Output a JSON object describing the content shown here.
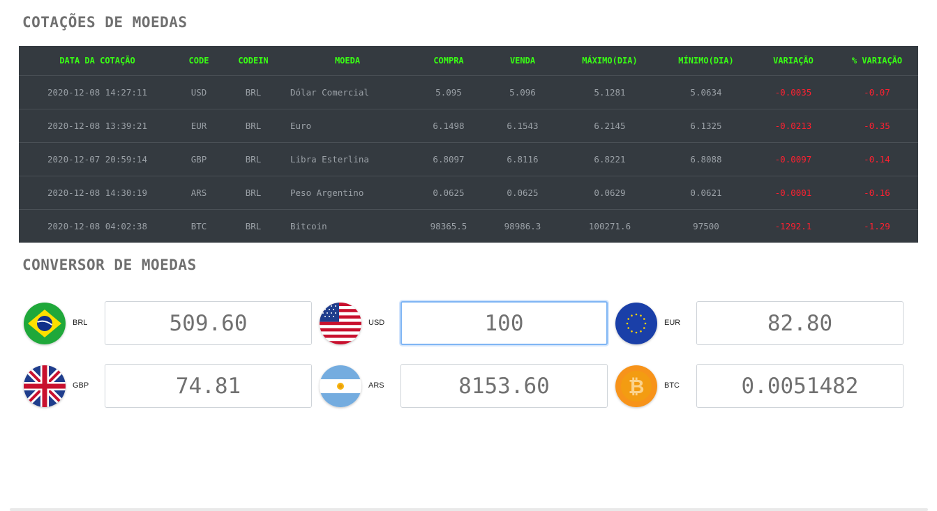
{
  "quotes_title": "COTAÇÕES DE MOEDAS",
  "converter_title": "CONVERSOR DE MOEDAS",
  "table": {
    "headers": [
      "DATA DA COTAÇÃO",
      "CODE",
      "CODEIN",
      "MOEDA",
      "COMPRA",
      "VENDA",
      "MÁXIMO(DIA)",
      "MÍNIMO(DIA)",
      "VARIAÇÃO",
      "% VARIAÇÃO"
    ],
    "rows": [
      [
        "2020-12-08 14:27:11",
        "USD",
        "BRL",
        "Dólar Comercial",
        "5.095",
        "5.096",
        "5.1281",
        "5.0634",
        "-0.0035",
        "-0.07"
      ],
      [
        "2020-12-08 13:39:21",
        "EUR",
        "BRL",
        "Euro",
        "6.1498",
        "6.1543",
        "6.2145",
        "6.1325",
        "-0.0213",
        "-0.35"
      ],
      [
        "2020-12-07 20:59:14",
        "GBP",
        "BRL",
        "Libra Esterlina",
        "6.8097",
        "6.8116",
        "6.8221",
        "6.8088",
        "-0.0097",
        "-0.14"
      ],
      [
        "2020-12-08 14:30:19",
        "ARS",
        "BRL",
        "Peso Argentino",
        "0.0625",
        "0.0625",
        "0.0629",
        "0.0621",
        "-0.0001",
        "-0.16"
      ],
      [
        "2020-12-08 04:02:38",
        "BTC",
        "BRL",
        "Bitcoin",
        "98365.5",
        "98986.3",
        "100271.6",
        "97500",
        "-1292.1",
        "-1.29"
      ]
    ]
  },
  "converter": {
    "BRL": {
      "code": "BRL",
      "value": "509.60"
    },
    "USD": {
      "code": "USD",
      "value": "100"
    },
    "EUR": {
      "code": "EUR",
      "value": "82.80"
    },
    "GBP": {
      "code": "GBP",
      "value": "74.81"
    },
    "ARS": {
      "code": "ARS",
      "value": "8153.60"
    },
    "BTC": {
      "code": "BTC",
      "value": "0.0051482"
    }
  },
  "colors": {
    "table_bg": "#343a40",
    "header_text": "#39ff14",
    "negative": "#ff2030",
    "title_text": "#707070"
  }
}
